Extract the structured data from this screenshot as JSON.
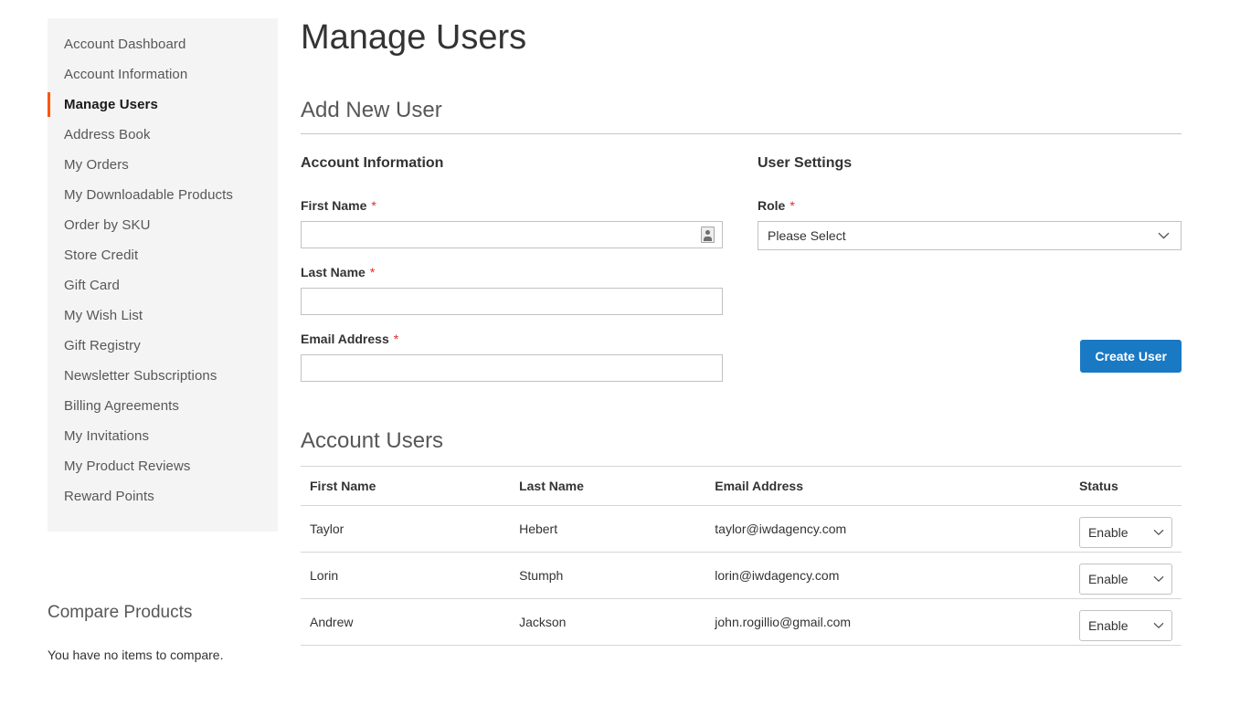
{
  "sidebar": {
    "items": [
      {
        "label": "Account Dashboard",
        "current": false
      },
      {
        "label": "Account Information",
        "current": false
      },
      {
        "label": "Manage Users",
        "current": true
      },
      {
        "label": "Address Book",
        "current": false
      },
      {
        "label": "My Orders",
        "current": false
      },
      {
        "label": "My Downloadable Products",
        "current": false
      },
      {
        "label": "Order by SKU",
        "current": false
      },
      {
        "label": "Store Credit",
        "current": false
      },
      {
        "label": "Gift Card",
        "current": false
      },
      {
        "label": "My Wish List",
        "current": false
      },
      {
        "label": "Gift Registry",
        "current": false
      },
      {
        "label": "Newsletter Subscriptions",
        "current": false
      },
      {
        "label": "Billing Agreements",
        "current": false
      },
      {
        "label": "My Invitations",
        "current": false
      },
      {
        "label": "My Product Reviews",
        "current": false
      },
      {
        "label": "Reward Points",
        "current": false
      }
    ],
    "active_marker_color": "#ff5501",
    "background_color": "#f4f4f4"
  },
  "compare": {
    "title": "Compare Products",
    "empty_message": "You have no items to compare."
  },
  "main": {
    "page_title": "Manage Users",
    "add_new_user_legend": "Add New User",
    "account_information": {
      "sub_legend": "Account Information",
      "fields": [
        {
          "label": "First Name",
          "required": "*",
          "value": "",
          "placeholder": ""
        },
        {
          "label": "Last Name",
          "required": "*",
          "value": "",
          "placeholder": ""
        },
        {
          "label": "Email Address",
          "required": "*",
          "value": "",
          "placeholder": ""
        }
      ]
    },
    "user_settings": {
      "sub_legend": "User Settings",
      "role_label": "Role",
      "role_required": "*",
      "role_selected": "Please Select"
    },
    "create_user_label": "Create User",
    "create_user_color": "#1979c3",
    "account_users": {
      "legend": "Account Users",
      "columns": [
        "First Name",
        "Last Name",
        "Email Address",
        "Status"
      ],
      "rows": [
        {
          "first_name": "Taylor",
          "last_name": "Hebert",
          "email": "taylor@iwdagency.com",
          "status": "Enable"
        },
        {
          "first_name": "Lorin",
          "last_name": "Stumph",
          "email": "lorin@iwdagency.com",
          "status": "Enable"
        },
        {
          "first_name": "Andrew",
          "last_name": "Jackson",
          "email": "john.rogillio@gmail.com",
          "status": "Enable"
        }
      ]
    }
  }
}
